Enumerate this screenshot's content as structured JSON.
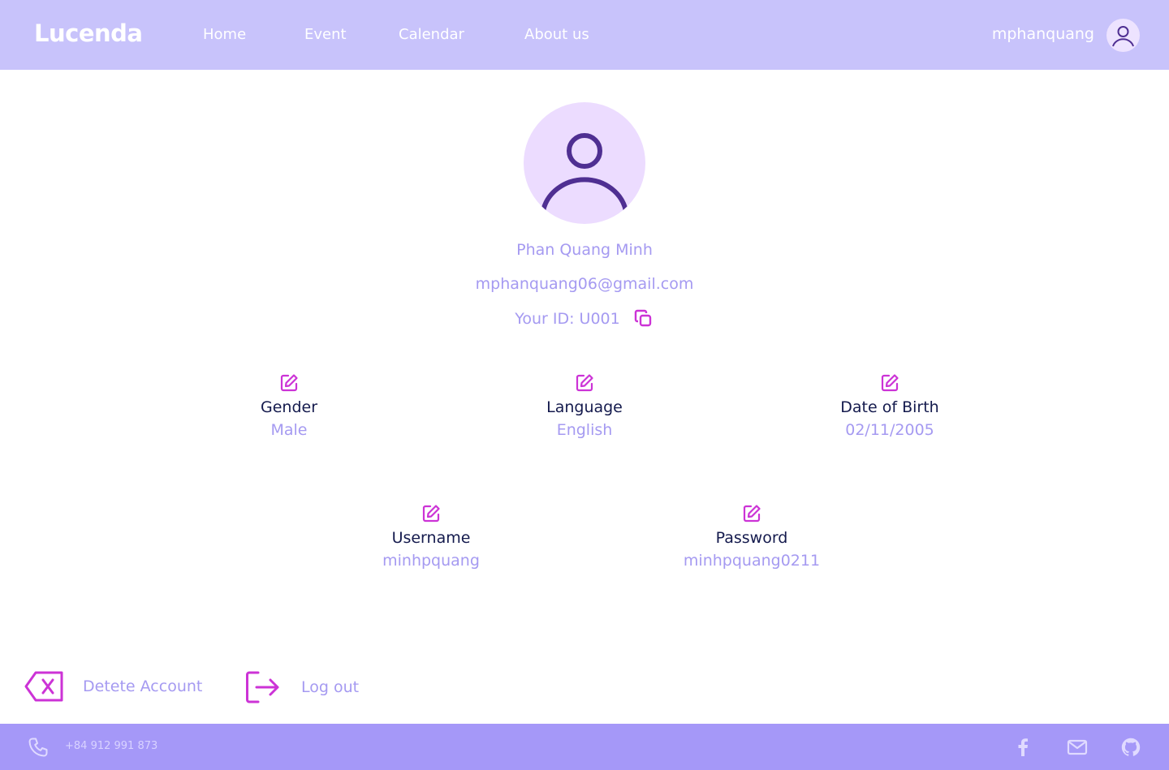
{
  "header": {
    "logo": "Lucenda",
    "nav": [
      "Home",
      "Event",
      "Calendar",
      "About us"
    ],
    "username": "mphanquang",
    "avatar_icon": "user-circle-icon"
  },
  "profile": {
    "full_name": "Phan Quang Minh",
    "email": "mphanquang06@gmail.com",
    "id_text": "Your ID: U001",
    "copy_icon": "copy-icon"
  },
  "fields": {
    "gender": {
      "label": "Gender",
      "value": "Male"
    },
    "language": {
      "label": "Language",
      "value": "English"
    },
    "dob": {
      "label": "Date of Birth",
      "value": "02/11/2005"
    },
    "username": {
      "label": "Username",
      "value": "minhpquang"
    },
    "password": {
      "label": "Password",
      "value": "minhpquang0211"
    }
  },
  "actions": {
    "delete_label": "Detete Account",
    "logout_label": "Log out"
  },
  "footer": {
    "phone": "+84 912 991 873",
    "icons": [
      "phone-icon",
      "facebook-icon",
      "mail-icon",
      "github-icon"
    ]
  },
  "colors": {
    "header_bg": "#c8c3fb",
    "footer_bg": "#a598f8",
    "accent_magenta": "#cc33d6",
    "text_light_purple": "#a59af1",
    "text_dark": "#141a4d",
    "avatar_bg": "#ecdcff",
    "avatar_stroke": "#4f2f92"
  }
}
